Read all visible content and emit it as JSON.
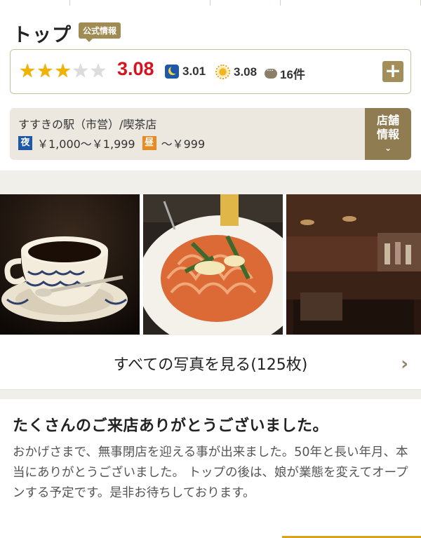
{
  "page": {
    "title": "トップ",
    "official_badge": "公式情報"
  },
  "rating": {
    "stars_filled": 3,
    "stars_total": 5,
    "score": "3.08",
    "night_score": "3.01",
    "day_score": "3.08",
    "review_count": "16件",
    "add_icon": "plus-icon"
  },
  "store_info": {
    "location_genre": "すすきの駅（市営）/喫茶店",
    "night_tag": "夜",
    "night_price": "￥1,000～￥1,999",
    "day_tag": "昼",
    "day_price": "～￥999",
    "store_button_label": "店舗\n情報",
    "store_button_line1": "店舗",
    "store_button_line2": "情報"
  },
  "gallery": {
    "all_photos_label": "すべての写真を見る(125枚)"
  },
  "notice": {
    "title": "たくさんのご来店ありがとうございました。",
    "body": "おかげさまで、無事閉店を迎える事が出来ました。50年と長い年月、本当にありがとうございました。 トップの後は、娘が業態を変えてオープンする予定です。是非お待ちしております。"
  },
  "colors": {
    "score_red": "#d8121f",
    "accent_gold": "#a28e58",
    "night_blue": "#1f58a6",
    "day_orange": "#e88b22"
  }
}
